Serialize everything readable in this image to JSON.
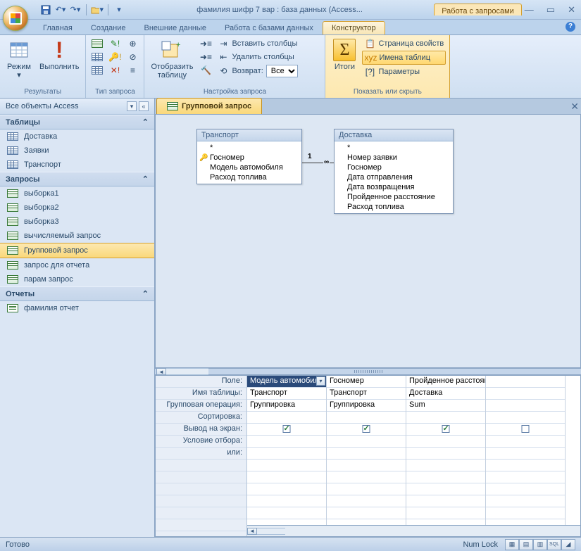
{
  "title": "фамилия шифр 7 вар : база данных (Access...",
  "context_tab": "Работа с запросами",
  "ribbon_tabs": [
    "Главная",
    "Создание",
    "Внешние данные",
    "Работа с базами данных",
    "Конструктор"
  ],
  "active_ribbon_tab_index": 4,
  "ribbon": {
    "results": {
      "label": "Результаты",
      "view": "Режим",
      "run": "Выполнить"
    },
    "querytype": {
      "label": "Тип запроса"
    },
    "setup": {
      "label": "Настройка запроса",
      "show_table": "Отобразить\nтаблицу",
      "insert_cols": "Вставить столбцы",
      "delete_cols": "Удалить столбцы",
      "return_lbl": "Возврат:",
      "return_val": "Все"
    },
    "showhide": {
      "label": "Показать или скрыть",
      "totals": "Итоги",
      "prop": "Страница свойств",
      "names": "Имена таблиц",
      "params": "Параметры"
    }
  },
  "nav": {
    "header": "Все объекты Access",
    "sections": {
      "tables": {
        "label": "Таблицы",
        "items": [
          "Доставка",
          "Заявки",
          "Транспорт"
        ]
      },
      "queries": {
        "label": "Запросы",
        "items": [
          "выборка1",
          "выборка2",
          "выборка3",
          "вычисляемый запрос",
          "Групповой запрос",
          "запрос для отчета",
          "парам запрос"
        ],
        "selected": 4
      },
      "reports": {
        "label": "Отчеты",
        "items": [
          "фамилия отчет"
        ]
      }
    }
  },
  "doc_tab": "Групповой запрос",
  "tables_on_surface": {
    "t1": {
      "title": "Транспорт",
      "fields": [
        "*",
        "Госномер",
        "Модель автомобиля",
        "Расход топлива"
      ],
      "key_index": 1
    },
    "t2": {
      "title": "Доставка",
      "fields": [
        "*",
        "Номер заявки",
        "Госномер",
        "Дата отправления",
        "Дата возвращения",
        "Пройденное расстояние",
        "Расход топлива"
      ]
    }
  },
  "join": {
    "left": "1",
    "right": "∞"
  },
  "qbe": {
    "row_labels": [
      "Поле:",
      "Имя таблицы:",
      "Групповая операция:",
      "Сортировка:",
      "Вывод на экран:",
      "Условие отбора:",
      "или:"
    ],
    "columns": [
      {
        "field": "Модель автомобиля",
        "table": "Транспорт",
        "group": "Группировка",
        "show": true,
        "selected": true
      },
      {
        "field": "Госномер",
        "table": "Транспорт",
        "group": "Группировка",
        "show": true
      },
      {
        "field": "Пройденное расстояние",
        "table": "Доставка",
        "group": "Sum",
        "show": true
      },
      {
        "field": "",
        "table": "",
        "group": "",
        "show": false
      }
    ]
  },
  "status": {
    "ready": "Готово",
    "numlock": "Num Lock"
  }
}
